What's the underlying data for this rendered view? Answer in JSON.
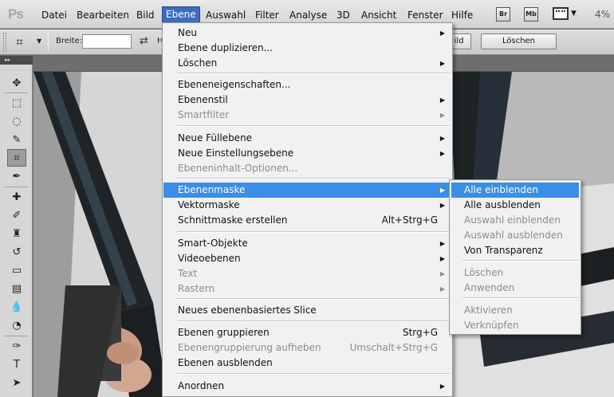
{
  "app": {
    "logo": "Ps",
    "zoom": "4%"
  },
  "menubar": {
    "items": [
      "Datei",
      "Bearbeiten",
      "Bild",
      "Ebene",
      "Auswahl",
      "Filter",
      "Analyse",
      "3D",
      "Ansicht",
      "Fenster",
      "Hilfe"
    ],
    "active": "Ebene",
    "badges": [
      "Br",
      "Mb"
    ]
  },
  "options": {
    "width_label": "Breite:",
    "width_value": "",
    "height_label": "H",
    "button_left": "ild",
    "button_clear": "Löschen"
  },
  "menu": {
    "items": [
      {
        "label": "Neu",
        "submenu": true
      },
      {
        "label": "Ebene duplizieren..."
      },
      {
        "label": "Löschen",
        "submenu": true
      },
      {
        "label": "Ebeneneigenschaften..."
      },
      {
        "label": "Ebenenstil",
        "submenu": true
      },
      {
        "label": "Smartfilter",
        "submenu": true,
        "disabled": true
      },
      {
        "label": "Neue Füllebene",
        "submenu": true
      },
      {
        "label": "Neue Einstellungsebene",
        "submenu": true
      },
      {
        "label": "Ebeneninhalt-Optionen...",
        "disabled": true
      },
      {
        "label": "Ebenenmaske",
        "submenu": true,
        "highlighted": true
      },
      {
        "label": "Vektormaske",
        "submenu": true
      },
      {
        "label": "Schnittmaske erstellen",
        "shortcut": "Alt+Strg+G"
      },
      {
        "label": "Smart-Objekte",
        "submenu": true
      },
      {
        "label": "Videoebenen",
        "submenu": true
      },
      {
        "label": "Text",
        "submenu": true,
        "disabled": true
      },
      {
        "label": "Rastern",
        "submenu": true,
        "disabled": true
      },
      {
        "label": "Neues ebenenbasiertes Slice"
      },
      {
        "label": "Ebenen gruppieren",
        "shortcut": "Strg+G"
      },
      {
        "label": "Ebenengruppierung aufheben",
        "shortcut": "Umschalt+Strg+G",
        "disabled": true
      },
      {
        "label": "Ebenen ausblenden"
      },
      {
        "label": "Anordnen",
        "submenu": true
      }
    ]
  },
  "submenu": {
    "items": [
      {
        "label": "Alle einblenden",
        "highlighted": true
      },
      {
        "label": "Alle ausblenden"
      },
      {
        "label": "Auswahl einblenden",
        "disabled": true
      },
      {
        "label": "Auswahl ausblenden",
        "disabled": true
      },
      {
        "label": "Von Transparenz"
      },
      {
        "label": "Löschen",
        "disabled": true
      },
      {
        "label": "Anwenden",
        "disabled": true
      },
      {
        "label": "Aktivieren",
        "disabled": true
      },
      {
        "label": "Verknüpfen",
        "disabled": true
      }
    ]
  },
  "tools": [
    "move-tool-icon",
    "marquee-tool-icon",
    "lasso-tool-icon",
    "quick-selection-tool-icon",
    "crop-tool-icon",
    "eyedropper-tool-icon",
    "healing-brush-tool-icon",
    "brush-tool-icon",
    "clone-stamp-tool-icon",
    "history-brush-tool-icon",
    "eraser-tool-icon",
    "gradient-tool-icon",
    "blur-tool-icon",
    "dodge-tool-icon",
    "pen-tool-icon",
    "type-tool-icon",
    "path-selection-tool-icon"
  ],
  "colors": {
    "highlight": "#3a8ee6",
    "active_menu": "#3b6cc2",
    "disabled_text": "#8c8c8c"
  }
}
